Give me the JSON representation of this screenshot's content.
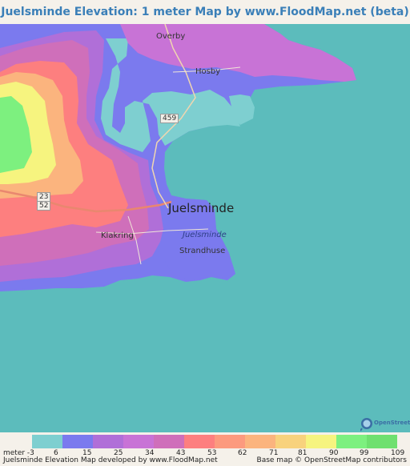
{
  "title": "Juelsminde Elevation: 1 meter Map by www.FloodMap.net (beta)",
  "places": {
    "overby": "Overby",
    "hosby": "Hosby",
    "juelsminde": "Juelsminde",
    "klakring": "Klakring",
    "strandhuse": "Strandhuse",
    "water": "Juelsminde"
  },
  "roads": {
    "r459": "459",
    "r23": "23",
    "r52": "52"
  },
  "legend": {
    "labels": [
      "meter -3",
      "6",
      "15",
      "25",
      "34",
      "43",
      "53",
      "62",
      "71",
      "81",
      "90",
      "99",
      "109"
    ],
    "colors": [
      "#7ecfd0",
      "#7b7aee",
      "#b06fd8",
      "#c873d6",
      "#cf6fba",
      "#fd7f7f",
      "#fc9a7e",
      "#fbb47e",
      "#f8d27d",
      "#f6f47f",
      "#7df07f",
      "#6fe06f"
    ]
  },
  "footer": {
    "left": "Juelsminde Elevation Map developed by www.FloodMap.net",
    "right": "Base map © OpenStreetMap contributors"
  },
  "osm_logo_text": "OpenStreetMap",
  "colors": {
    "sea": "#5cbcbc",
    "low": "#7ecfd0",
    "blue": "#7b7aee",
    "purple": "#b06fd8",
    "magenta": "#cf6fba",
    "red": "#fd7f7f",
    "orange": "#fbb47e",
    "yellow": "#f6f47f",
    "green": "#7df07f",
    "title": "#3a7fb8"
  }
}
